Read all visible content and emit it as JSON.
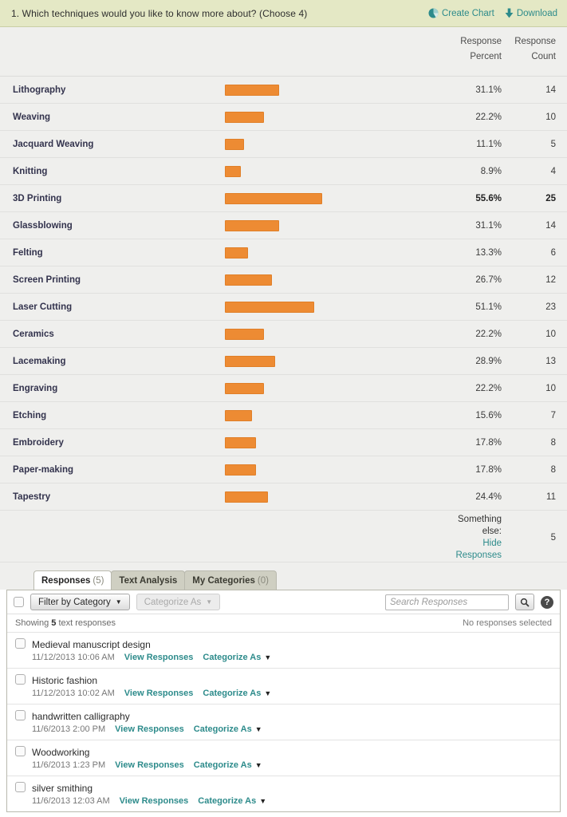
{
  "header": {
    "question": "1. Which techniques would you like to know more about? (Choose 4)",
    "create_chart_label": "Create Chart",
    "download_label": "Download",
    "accent_teal": "#2d8b8b",
    "background": "#e4e8c5"
  },
  "table": {
    "col_pct_l1": "Response",
    "col_pct_l2": "Percent",
    "col_cnt_l1": "Response",
    "col_cnt_l2": "Count",
    "bar_color": "#ed8b33"
  },
  "other": {
    "title": "Something else:",
    "hide_link": "Hide Responses",
    "count": "5"
  },
  "tabs": [
    {
      "label": "Responses",
      "count": "(5)",
      "active": true
    },
    {
      "label": "Text Analysis",
      "count": "",
      "active": false
    },
    {
      "label": "My Categories",
      "count": "(0)",
      "active": false
    }
  ],
  "toolbar": {
    "filter_label": "Filter by Category",
    "categorize_label": "Categorize As",
    "search_placeholder": "Search Responses",
    "help_label": "?"
  },
  "status": {
    "showing_prefix": "Showing",
    "showing_count": "5",
    "showing_suffix": "text responses",
    "selection": "No responses selected"
  },
  "responses": [
    {
      "text": "Medieval manuscript design",
      "date": "11/12/2013 10:06 AM",
      "view": "View Responses",
      "categorize": "Categorize As"
    },
    {
      "text": "Historic fashion",
      "date": "11/12/2013 10:02 AM",
      "view": "View Responses",
      "categorize": "Categorize As"
    },
    {
      "text": "handwritten calligraphy",
      "date": "11/6/2013 2:00 PM",
      "view": "View Responses",
      "categorize": "Categorize As"
    },
    {
      "text": "Woodworking",
      "date": "11/6/2013 1:23 PM",
      "view": "View Responses",
      "categorize": "Categorize As"
    },
    {
      "text": "silver smithing",
      "date": "11/6/2013 12:03 AM",
      "view": "View Responses",
      "categorize": "Categorize As"
    }
  ],
  "chart_data": {
    "type": "bar",
    "title": "1. Which techniques would you like to know more about? (Choose 4)",
    "xlabel": "Response Percent",
    "ylabel": "",
    "orientation": "horizontal",
    "xlim": [
      0,
      100
    ],
    "grid": false,
    "legend": false,
    "categories": [
      "Lithography",
      "Weaving",
      "Jacquard Weaving",
      "Knitting",
      "3D Printing",
      "Glassblowing",
      "Felting",
      "Screen Printing",
      "Laser Cutting",
      "Ceramics",
      "Lacemaking",
      "Engraving",
      "Etching",
      "Embroidery",
      "Paper-making",
      "Tapestry"
    ],
    "values": [
      31.1,
      22.2,
      11.1,
      8.9,
      55.6,
      31.1,
      13.3,
      26.7,
      51.1,
      22.2,
      28.9,
      22.2,
      15.6,
      17.8,
      17.8,
      24.4
    ],
    "percent_labels": [
      "31.1%",
      "22.2%",
      "11.1%",
      "8.9%",
      "55.6%",
      "31.1%",
      "13.3%",
      "26.7%",
      "51.1%",
      "22.2%",
      "28.9%",
      "22.2%",
      "15.6%",
      "17.8%",
      "17.8%",
      "24.4%"
    ],
    "counts": [
      14,
      10,
      5,
      4,
      25,
      14,
      6,
      12,
      23,
      10,
      13,
      10,
      7,
      8,
      8,
      11
    ],
    "max_index": 4,
    "other_label": "Something else:",
    "other_count": 5
  }
}
